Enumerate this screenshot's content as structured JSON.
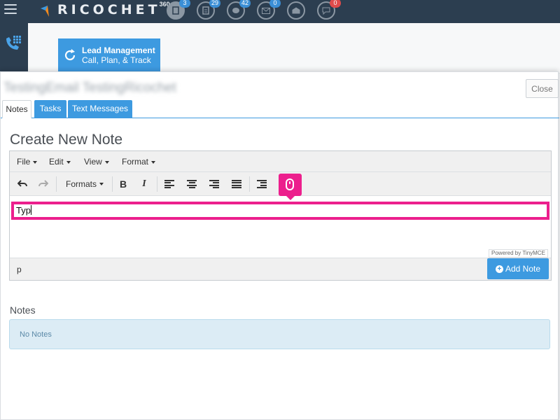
{
  "app": {
    "logo_text": "RICOCHET",
    "logo_sup": "360"
  },
  "nav": {
    "icons": [
      {
        "name": "document-icon",
        "badge": "3",
        "badge_color": "#3b8fd6"
      },
      {
        "name": "report-icon",
        "badge": "29",
        "badge_color": "#3b8fd6"
      },
      {
        "name": "chat-icon",
        "badge": "42",
        "badge_color": "#3b8fd6"
      },
      {
        "name": "mail-icon",
        "badge": "0",
        "badge_color": "#3b8fd6"
      },
      {
        "name": "envelope-open-icon",
        "badge": "",
        "badge_color": ""
      },
      {
        "name": "speech-bubble-icon",
        "badge": "0",
        "badge_color": "#e04b4b"
      }
    ]
  },
  "lead": {
    "title": "Lead Management",
    "subtitle": "Call, Plan, & Track"
  },
  "panel": {
    "contact_name": "TestingEmail TestingRicochet",
    "close_label": "Close",
    "tabs": [
      {
        "label": "Notes",
        "active": true
      },
      {
        "label": "Tasks",
        "active": false
      },
      {
        "label": "Text Messages",
        "active": false
      }
    ],
    "create_title": "Create New Note",
    "editor": {
      "menus": [
        "File",
        "Edit",
        "View",
        "Format"
      ],
      "formats_label": "Formats",
      "bold_label": "B",
      "italic_label": "I",
      "content": "Typ",
      "powered_by": "Powered by TinyMCE",
      "path": "p"
    },
    "add_note_label": "Add Note",
    "notes_title": "Notes",
    "no_notes": "No Notes"
  },
  "colors": {
    "accent": "#3d9ae0",
    "highlight": "#ec1f8d",
    "nav_bg": "#2c3e50"
  }
}
